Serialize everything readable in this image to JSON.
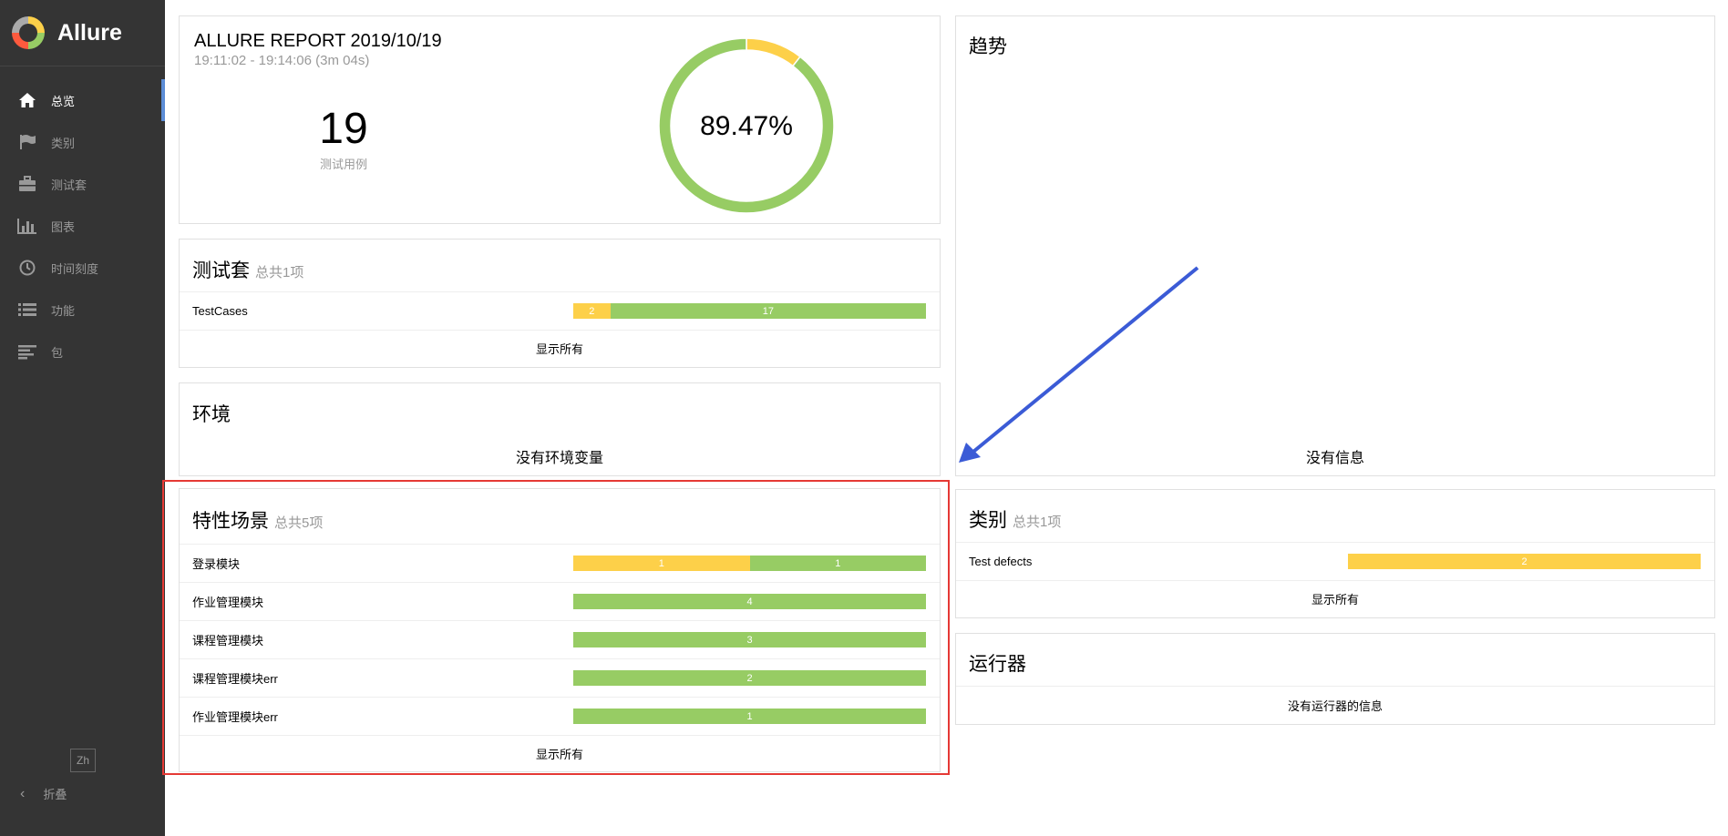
{
  "app": {
    "name": "Allure"
  },
  "sidebar": {
    "items": [
      {
        "label": "总览",
        "icon": "home-icon"
      },
      {
        "label": "类别",
        "icon": "flag-icon"
      },
      {
        "label": "测试套",
        "icon": "briefcase-icon"
      },
      {
        "label": "图表",
        "icon": "bar-chart-icon"
      },
      {
        "label": "时间刻度",
        "icon": "clock-icon"
      },
      {
        "label": "功能",
        "icon": "list-icon"
      },
      {
        "label": "包",
        "icon": "align-left-icon"
      }
    ],
    "lang": "Zh",
    "collapse_label": "折叠"
  },
  "summary": {
    "title": "ALLURE REPORT 2019/10/19",
    "time_range": "19:11:02 - 19:14:06 (3m 04s)",
    "test_count": "19",
    "test_count_label": "测试用例",
    "pass_rate": "89.47%",
    "donut": {
      "broken": 2,
      "passed": 17
    }
  },
  "suites": {
    "title": "测试套",
    "subtitle": "总共1项",
    "rows": [
      {
        "name": "TestCases",
        "broken": 2,
        "passed": 17,
        "broken_label": "2",
        "passed_label": "17"
      }
    ],
    "show_all": "显示所有"
  },
  "environment": {
    "title": "环境",
    "empty": "没有环境变量"
  },
  "features": {
    "title": "特性场景",
    "subtitle": "总共5项",
    "rows": [
      {
        "name": "登录模块",
        "broken": 1,
        "passed": 1,
        "broken_label": "1",
        "passed_label": "1"
      },
      {
        "name": "作业管理模块",
        "broken": 0,
        "passed": 4,
        "broken_label": "",
        "passed_label": "4"
      },
      {
        "name": "课程管理模块",
        "broken": 0,
        "passed": 3,
        "broken_label": "",
        "passed_label": "3"
      },
      {
        "name": "课程管理模块err",
        "broken": 0,
        "passed": 2,
        "broken_label": "",
        "passed_label": "2"
      },
      {
        "name": "作业管理模块err",
        "broken": 0,
        "passed": 1,
        "broken_label": "",
        "passed_label": "1"
      }
    ],
    "show_all": "显示所有"
  },
  "trend": {
    "title": "趋势",
    "empty": "没有信息"
  },
  "categories": {
    "title": "类别",
    "subtitle": "总共1项",
    "rows": [
      {
        "name": "Test defects",
        "broken": 2,
        "passed": 0,
        "broken_label": "2",
        "passed_label": ""
      }
    ],
    "show_all": "显示所有"
  },
  "executors": {
    "title": "运行器",
    "empty": "没有运行器的信息"
  },
  "colors": {
    "sidebar_bg": "#343434",
    "passed": "#97cc64",
    "broken": "#fdd049",
    "highlight_box": "#e53935",
    "arrow": "#3b5bd6"
  }
}
